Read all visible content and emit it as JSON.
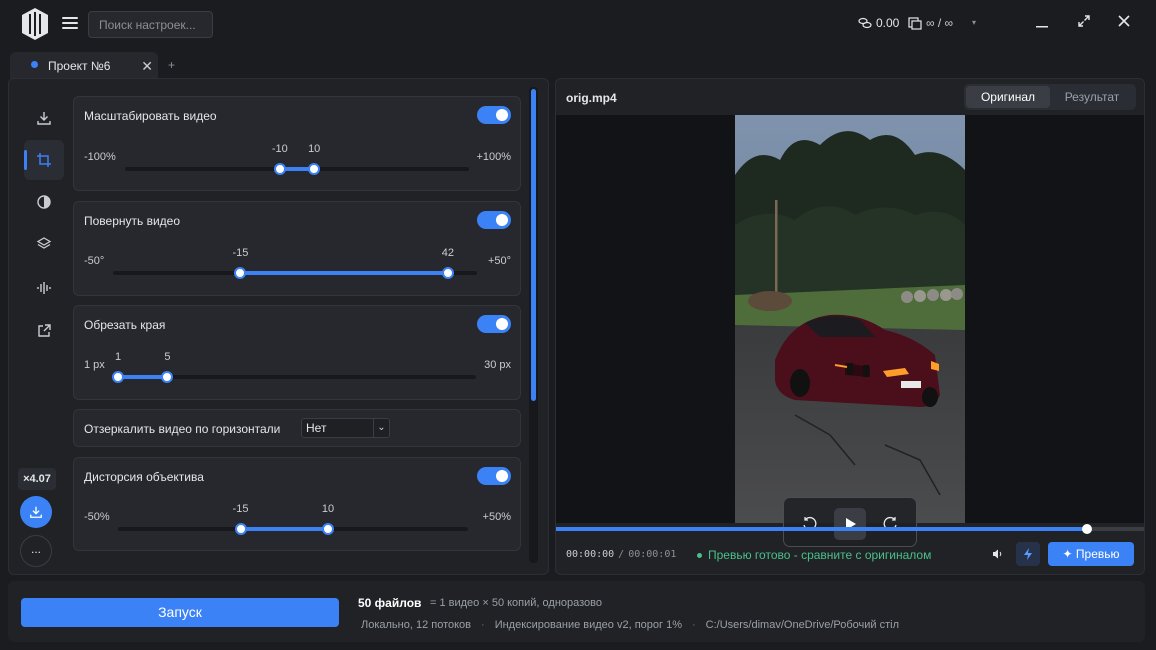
{
  "app": {
    "search_placeholder": "Поиск настроек...",
    "credits": "0.00",
    "limits": "∞ / ∞"
  },
  "tabs": [
    {
      "label": "Проект №6",
      "active": true
    }
  ],
  "tab_add": "+",
  "rail": {
    "items": [
      "download-icon",
      "crop-icon",
      "contrast-icon",
      "layers-icon",
      "audio-icon",
      "export-icon"
    ],
    "active": "crop-icon",
    "speed": "×4.07",
    "more": "..."
  },
  "settings": {
    "scale": {
      "title": "Масштабировать видео",
      "enabled": true,
      "min_label": "-100%",
      "max_label": "+100%",
      "min": -100,
      "max": 100,
      "low": -10,
      "high": 10,
      "low_label": "-10",
      "high_label": "10"
    },
    "rotate": {
      "title": "Повернуть видео",
      "enabled": true,
      "min_label": "-50°",
      "max_label": "+50°",
      "min": -50,
      "max": 50,
      "low": -15,
      "high": 42,
      "low_label": "-15",
      "high_label": "42"
    },
    "crop": {
      "title": "Обрезать края",
      "enabled": true,
      "min_label": "1 px",
      "max_label": "30 px",
      "min": 1,
      "max": 30,
      "low": 1,
      "high": 5,
      "low_label": "1",
      "high_label": "5"
    },
    "mirror": {
      "title": "Отзеркалить видео по горизонтали",
      "value": "Нет"
    },
    "distortion": {
      "title": "Дисторсия объектива",
      "enabled": true,
      "min_label": "-50%",
      "max_label": "+50%",
      "min": -50,
      "max": 50,
      "low": -15,
      "high": 10,
      "low_label": "-15",
      "high_label": "10"
    }
  },
  "preview": {
    "file_name": "orig.mp4",
    "view_tabs": [
      "Оригинал",
      "Результат"
    ],
    "active_view": "Оригинал",
    "progress": 0.9,
    "time_current": "00:00:00",
    "time_total": "00:00:01",
    "status": "Превью готово - сравните с оригиналом",
    "preview_button": "✦ Превью"
  },
  "bottom": {
    "run_label": "Запуск",
    "files": "50 файлов",
    "files_note": "= 1 видео × 50 копий, одноразово",
    "meta": [
      "Локально, 12 потоков",
      "Индексирование видео v2, порог 1%",
      "C:/Users/dimav/OneDrive/Робочий стіл"
    ]
  },
  "colors": {
    "accent": "#3b82f6",
    "status_ok": "#4ac08a",
    "bg": "#1a1c20",
    "panel": "#202226"
  }
}
